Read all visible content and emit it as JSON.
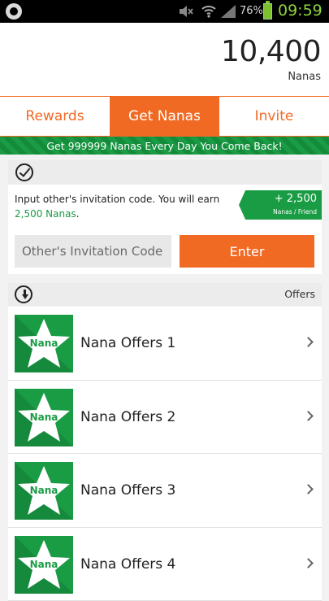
{
  "status_bar": {
    "battery_percent": "76%",
    "time": "09:59",
    "icons": [
      "app-icon",
      "mute-icon",
      "wifi-icon",
      "signal-icon",
      "battery-icon"
    ]
  },
  "balance": {
    "amount": "10,400",
    "unit": "Nanas"
  },
  "tabs": [
    {
      "label": "Rewards",
      "active": false
    },
    {
      "label": "Get Nanas",
      "active": true
    },
    {
      "label": "Invite",
      "active": false
    }
  ],
  "banner": {
    "text": "Get 999999 Nanas Every Day You Come Back!"
  },
  "invite": {
    "text_prefix": "Input other's invitation code. You will earn ",
    "highlight": "2,500 Nanas",
    "text_suffix": ".",
    "reward_amount": "+ 2,500",
    "reward_unit": "Nanas / Friend",
    "input_placeholder": "Other's Invitation Code",
    "input_value": "",
    "enter_label": "Enter"
  },
  "offers": {
    "header_label": "Offers",
    "badge_text": "Nana",
    "items": [
      {
        "name": "Nana Offers 1"
      },
      {
        "name": "Nana Offers 2"
      },
      {
        "name": "Nana Offers 3"
      },
      {
        "name": "Nana Offers 4"
      }
    ]
  },
  "colors": {
    "accent_orange": "#f16a24",
    "brand_green": "#1a9c45",
    "clock_green": "#8ed53a"
  }
}
